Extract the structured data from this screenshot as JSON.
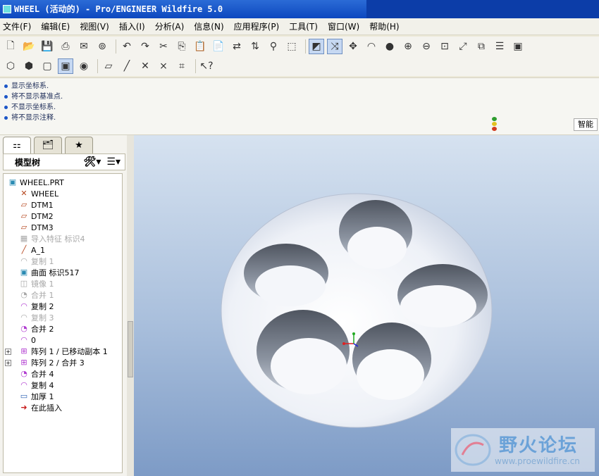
{
  "window": {
    "title": "WHEEL (活动的) - Pro/ENGINEER Wildfire 5.0"
  },
  "menu": {
    "items": [
      "文件(F)",
      "编辑(E)",
      "视图(V)",
      "插入(I)",
      "分析(A)",
      "信息(N)",
      "应用程序(P)",
      "工具(T)",
      "窗口(W)",
      "帮助(H)"
    ]
  },
  "messages": [
    "显示坐标系.",
    "将不显示基准点.",
    "不显示坐标系.",
    "将不显示注释."
  ],
  "smart_filter": "智能",
  "tree": {
    "header": "模型树",
    "nodes": [
      {
        "label": "WHEEL.PRT",
        "icon": "part-icon",
        "dim": false
      },
      {
        "label": "WHEEL",
        "icon": "csys-icon",
        "dim": false
      },
      {
        "label": "DTM1",
        "icon": "datum-plane-icon",
        "dim": false
      },
      {
        "label": "DTM2",
        "icon": "datum-plane-icon",
        "dim": false
      },
      {
        "label": "DTM3",
        "icon": "datum-plane-icon",
        "dim": false
      },
      {
        "label": "导入特征 标识4",
        "icon": "import-icon",
        "dim": true
      },
      {
        "label": "A_1",
        "icon": "axis-icon",
        "dim": false
      },
      {
        "label": "复制 1",
        "icon": "copy-icon",
        "dim": true
      },
      {
        "label": "曲面 标识517",
        "icon": "surface-icon",
        "dim": false
      },
      {
        "label": "镜像 1",
        "icon": "mirror-icon",
        "dim": true
      },
      {
        "label": "合并 1",
        "icon": "merge-icon",
        "dim": true
      },
      {
        "label": "复制 2",
        "icon": "copy-icon",
        "dim": false
      },
      {
        "label": "复制 3",
        "icon": "copy-icon",
        "dim": true
      },
      {
        "label": "合并 2",
        "icon": "merge-icon",
        "dim": false
      },
      {
        "label": "0",
        "icon": "copy-icon",
        "dim": false
      },
      {
        "label": "阵列 1 / 已移动副本 1",
        "icon": "pattern-icon",
        "dim": false
      },
      {
        "label": "阵列 2 / 合并 3",
        "icon": "pattern-icon",
        "dim": false
      },
      {
        "label": "合并 4",
        "icon": "merge-icon",
        "dim": false
      },
      {
        "label": "复制 4",
        "icon": "copy-icon",
        "dim": false
      },
      {
        "label": "加厚 1",
        "icon": "thicken-icon",
        "dim": false
      },
      {
        "label": "在此插入",
        "icon": "insert-here-icon",
        "dim": false
      }
    ]
  },
  "watermark": {
    "title": "野火论坛",
    "url": "www.proewildfire.cn"
  },
  "colors": {
    "titlebar": "#0d48bf",
    "viewport_top": "#d6e2f0",
    "viewport_bottom": "#7d9bc6",
    "model": "#f4f6fa"
  }
}
